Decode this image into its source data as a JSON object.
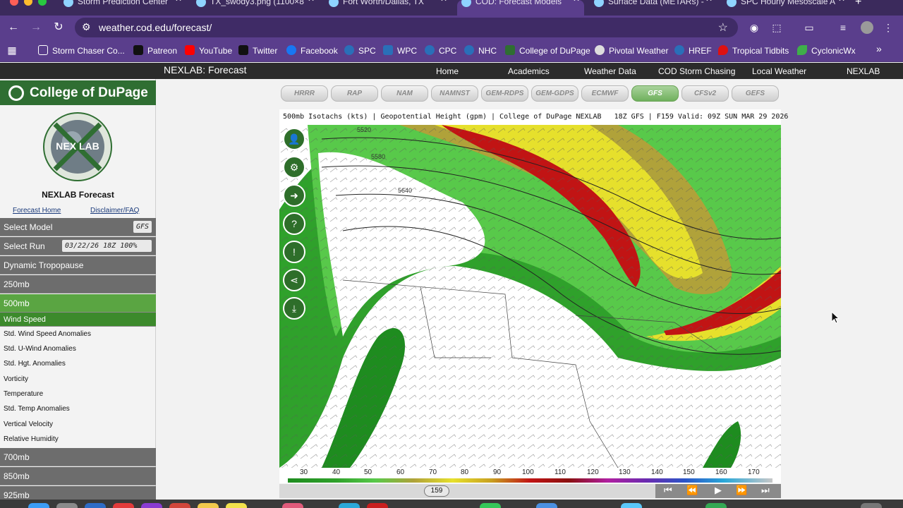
{
  "browser": {
    "tabs": [
      {
        "title": "Storm Prediction Center",
        "active": false
      },
      {
        "title": "TX_swody3.png (1100×8",
        "active": false
      },
      {
        "title": "Fort Worth/Dallas, TX",
        "active": false
      },
      {
        "title": "COD: Forecast Models",
        "active": true
      },
      {
        "title": "Surface Data (METARs) -",
        "active": false
      },
      {
        "title": "SPC Hourly Mesoscale A",
        "active": false
      }
    ],
    "url": "weather.cod.edu/forecast/",
    "bookmarks": [
      {
        "label": "Storm Chaser Co...",
        "icon": "folder-icon",
        "color": "#5a3e8c"
      },
      {
        "label": "Patreon",
        "icon": "patreon-icon",
        "color": "#111111"
      },
      {
        "label": "YouTube",
        "icon": "youtube-icon",
        "color": "#ff0000"
      },
      {
        "label": "Twitter",
        "icon": "x-icon",
        "color": "#111111"
      },
      {
        "label": "Facebook",
        "icon": "facebook-icon",
        "color": "#1877f2"
      },
      {
        "label": "SPC",
        "icon": "noaa-icon",
        "color": "#2a6fb8"
      },
      {
        "label": "WPC",
        "icon": "wpc-icon",
        "color": "#2a6fb8"
      },
      {
        "label": "CPC",
        "icon": "noaa-icon",
        "color": "#2a6fb8"
      },
      {
        "label": "NHC",
        "icon": "noaa-icon",
        "color": "#2a6fb8"
      },
      {
        "label": "College of DuPage",
        "icon": "cod-icon",
        "color": "#2f6e32"
      },
      {
        "label": "Pivotal Weather",
        "icon": "cloud-icon",
        "color": "#444444"
      },
      {
        "label": "HREF",
        "icon": "noaa-icon",
        "color": "#2a6fb8"
      },
      {
        "label": "Tropical Tidbits",
        "icon": "drop-icon",
        "color": "#d11"
      },
      {
        "label": "CyclonicWx",
        "icon": "leaf-icon",
        "color": "#3fae4a"
      }
    ]
  },
  "site": {
    "brand": "NEXLAB: Forecast",
    "nav": [
      "Home",
      "Academics",
      "Weather Data",
      "COD Storm Chasing",
      "Local Weather",
      "NEXLAB"
    ]
  },
  "sidebar": {
    "logo_text": "College of DuPage",
    "seal_text": "NEX LAB",
    "title": "NEXLAB Forecast",
    "links": [
      "Forecast Home",
      "Disclaimer/FAQ"
    ],
    "select_model_label": "Select Model",
    "select_model_value": "GFS",
    "select_run_label": "Select Run",
    "select_run_value": "03/22/26 18Z 100%",
    "levels_top": [
      "Dynamic Tropopause",
      "250mb",
      "500mb"
    ],
    "active_param": "Wind Speed",
    "params": [
      "Std. Wind Speed Anomalies",
      "Std. U-Wind Anomalies",
      "Std. Hgt. Anomalies",
      "Vorticity",
      "Temperature",
      "Std. Temp Anomalies",
      "Vertical Velocity",
      "Relative Humidity"
    ],
    "levels_bottom": [
      "700mb",
      "850mb",
      "925mb"
    ]
  },
  "models": [
    "HRRR",
    "RAP",
    "NAM",
    "NAMNST",
    "GEM-RDPS",
    "GEM-GDPS",
    "ECMWF",
    "GFS",
    "CFSv2",
    "GEFS"
  ],
  "active_model": "GFS",
  "map": {
    "title": "500mb Isotachs (kts) | Geopotential Height (gpm) | College of DuPage NEXLAB   18Z GFS | F159 Valid: 09Z SUN MAR 29 2026",
    "contour_labels": [
      "5520",
      "5580",
      "5640"
    ],
    "controls": [
      "user-icon",
      "gear-icon",
      "arrow-icon",
      "help-icon",
      "alert-icon",
      "share-icon",
      "download-icon"
    ],
    "colorbar_ticks": [
      "30",
      "40",
      "50",
      "60",
      "70",
      "80",
      "90",
      "100",
      "110",
      "120",
      "130",
      "140",
      "150",
      "160",
      "170"
    ],
    "forecast_hour": "159"
  },
  "colors": {
    "chrome": "#5a3e8c",
    "cod_green": "#2f6e32",
    "sidebar_active": "#5aa542"
  }
}
